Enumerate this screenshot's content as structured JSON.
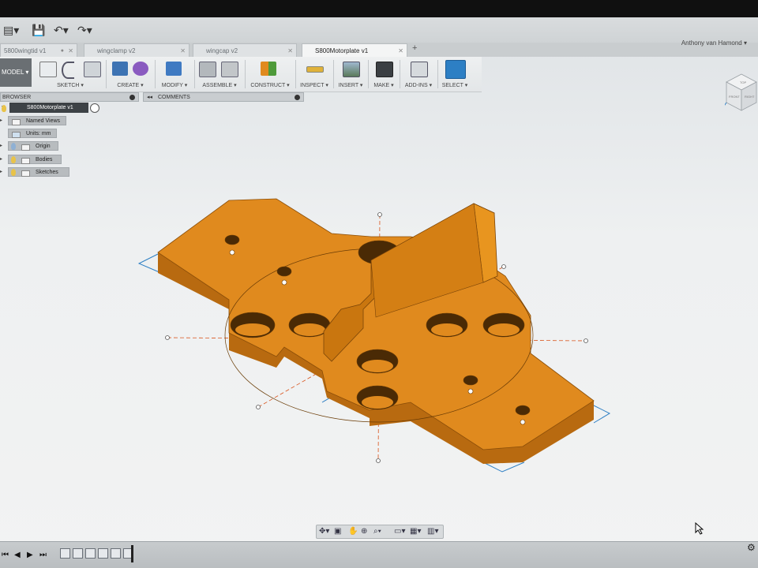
{
  "window": {
    "user_name": "Anthony van Hamond ▾",
    "tabs": [
      {
        "label": "5800wingtid v1",
        "active": false
      },
      {
        "label": "wingclamp v2",
        "active": false
      },
      {
        "label": "wingcap v2",
        "active": false
      },
      {
        "label": "S800Motorplate v1",
        "active": true
      }
    ],
    "add_tab": "+"
  },
  "toolbar": {
    "workspace": "MODEL ▾",
    "groups": [
      {
        "label": "SKETCH ▾"
      },
      {
        "label": "CREATE ▾"
      },
      {
        "label": "MODIFY ▾"
      },
      {
        "label": "ASSEMBLE ▾"
      },
      {
        "label": "CONSTRUCT ▾"
      },
      {
        "label": "INSPECT ▾"
      },
      {
        "label": "INSERT ▾"
      },
      {
        "label": "MAKE ▾"
      },
      {
        "label": "ADD-INS ▾"
      },
      {
        "label": "SELECT ▾"
      }
    ]
  },
  "browser": {
    "header": "BROWSER",
    "root": "S800Motorplate v1",
    "items": [
      {
        "label": "Named Views"
      },
      {
        "label": "Units: mm"
      },
      {
        "label": "Origin"
      },
      {
        "label": "Bodies"
      },
      {
        "label": "Sketches"
      }
    ]
  },
  "comments": {
    "header": "COMMENTS",
    "toggle": "◂◂"
  },
  "viewcube": {
    "top": "TOP",
    "front": "FRONT",
    "right": "RIGHT"
  },
  "colors": {
    "body": "#e08a1e",
    "body_dark": "#b86a10",
    "body_side": "#c9760f",
    "construction": "#d9541c",
    "select_accent": "#2d7fc4"
  }
}
